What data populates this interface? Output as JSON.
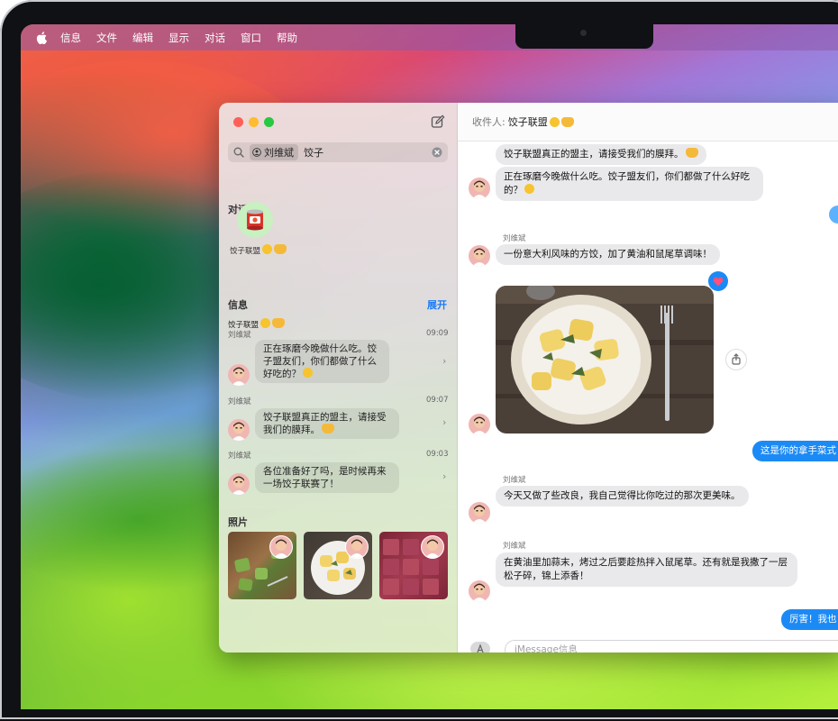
{
  "menubar": {
    "items": [
      "信息",
      "文件",
      "编辑",
      "显示",
      "对话",
      "窗口",
      "帮助"
    ]
  },
  "sidebar": {
    "search": {
      "token": "刘维斌",
      "query": "饺子"
    },
    "conversations_heading": "对话",
    "conversation": {
      "name": "饺子联盟"
    },
    "messages_heading": "信息",
    "expand_label": "展开",
    "results": [
      {
        "group": "饺子联盟",
        "sender": "刘维斌",
        "time": "09:09",
        "text": "正在琢磨今晚做什么吃。饺子盟友们，你们都做了什么好吃的？"
      },
      {
        "sender": "刘维斌",
        "time": "09:07",
        "text": "饺子联盟真正的盟主，请接受我们的膜拜。"
      },
      {
        "sender": "刘维斌",
        "time": "09:03",
        "text": "各位准备好了吗，是时候再来一场饺子联赛了！"
      }
    ],
    "photos_heading": "照片"
  },
  "chat": {
    "to_label": "收件人:",
    "to_name": "饺子联盟",
    "messages": [
      {
        "text": "饺子联盟真正的盟主，请接受我们的膜拜。"
      },
      {
        "text": "正在琢磨今晚做什么吃。饺子盟友们，你们都做了什么好吃的？"
      },
      {
        "sender": "刘维斌",
        "text": "一份意大利风味的方饺，加了黄油和鼠尾草调味！"
      },
      {
        "out": "这是你的拿手菜式"
      },
      {
        "sender": "刘维斌",
        "text": "今天又做了些改良，我自己觉得比你吃过的那次更美味。"
      },
      {
        "sender": "刘维斌",
        "text": "在黄油里加蒜末，烤过之后要趁热拌入鼠尾草。还有就是我撒了一层松子碎，锦上添香！"
      },
      {
        "out": "厉害！我也"
      }
    ],
    "input_placeholder": "iMessage信息"
  },
  "colors": {
    "accent": "#1c8af5",
    "close": "#fe5f57",
    "minimize": "#febc2e",
    "zoom": "#28c840"
  }
}
